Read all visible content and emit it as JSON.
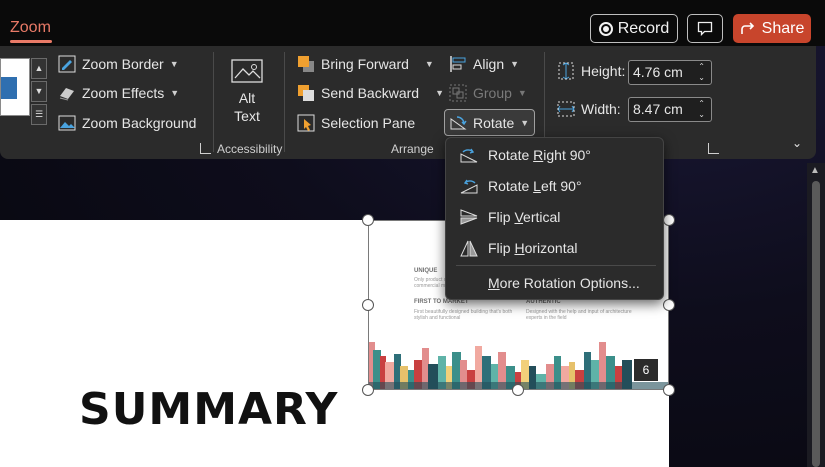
{
  "tab": {
    "label": "Zoom"
  },
  "top_actions": {
    "record_label": "Record",
    "share_label": "Share"
  },
  "ribbon": {
    "zoom_border": "Zoom Border",
    "zoom_effects": "Zoom Effects",
    "zoom_background": "Zoom Background",
    "alt_text_line1": "Alt",
    "alt_text_line2": "Text",
    "accessibility_group": "Accessibility",
    "bring_forward": "Bring Forward",
    "send_backward": "Send Backward",
    "selection_pane": "Selection Pane",
    "align": "Align",
    "group": "Group",
    "rotate": "Rotate",
    "arrange_group": "Arrange",
    "height_label": "Height:",
    "height_value": "4.76 cm",
    "width_label": "Width:",
    "width_value": "8.47 cm"
  },
  "rotate_menu": {
    "items": [
      {
        "pre": "Rotate ",
        "key": "R",
        "post": "ight 90°"
      },
      {
        "pre": "Rotate ",
        "key": "L",
        "post": "eft 90°"
      },
      {
        "pre": "Flip ",
        "key": "V",
        "post": "ertical"
      },
      {
        "pre": "Flip ",
        "key": "H",
        "post": "orizontal"
      },
      {
        "pre": "",
        "key": "M",
        "post": "ore Rotation Options..."
      }
    ]
  },
  "slide": {
    "title": "SUMMARY",
    "thumbnail": {
      "heading1": "UNIQUE",
      "text1a": "Only product on the market designed for",
      "text1b": "commercial markets",
      "heading2": "FIRST TO MARKET",
      "text2a": "First beautifully designed building that's both",
      "text2b": "stylish and functional",
      "heading3": "AUTHENTIC",
      "text3a": "Designed with the help and input of architecture",
      "text3b": "experts in the field",
      "page_number": "6"
    }
  },
  "colors": {
    "accent": "#e97a67",
    "share": "#c8452c",
    "ribbon": "#2b2b2b"
  }
}
